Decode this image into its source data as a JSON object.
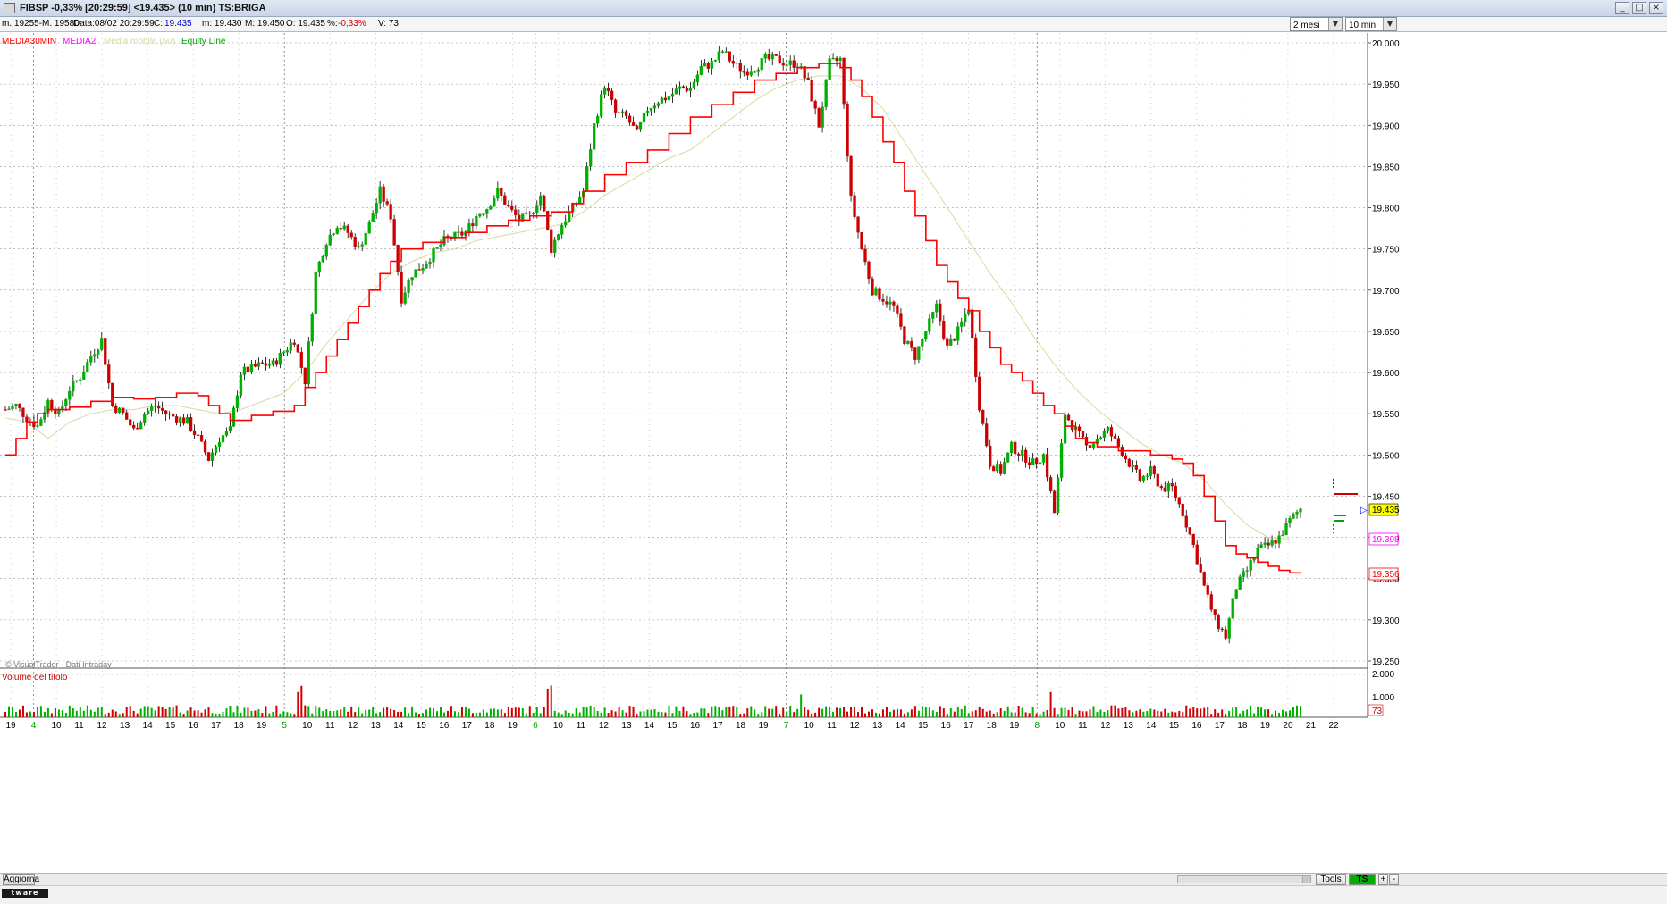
{
  "window": {
    "title": "FIBSP -0,33% [20:29:59]  <19.435> (10 min) TS:BRIGA",
    "controls": [
      "minimize",
      "maximize",
      "close"
    ]
  },
  "infobar": {
    "range": "m. 19255-M. 19580",
    "date": "Data:08/02 20:29:59",
    "close_lbl": "C:",
    "close_val": "19.435",
    "min": "m: 19.430",
    "max": "M: 19.450",
    "open": "O: 19.435",
    "pct_lbl": "%:",
    "pct_val": "-0,33%",
    "vol": "V: 73",
    "period_select": "2 mesi",
    "interval_select": "10 min"
  },
  "legend": [
    {
      "label": "MEDIA30MIN",
      "color": "#ff0000"
    },
    {
      "label": "MEDIA2",
      "color": "#ff00ff"
    },
    {
      "label": "Media mobile (50)",
      "color": "#d8d8a0"
    },
    {
      "label": "Equity Line",
      "color": "#00a000"
    }
  ],
  "copyright": "© VisualTrader - Dati Intraday",
  "volume_label": "Volume del titolo",
  "price_markers": {
    "last": "19.435",
    "media2": "19.398",
    "media30": "19.356"
  },
  "bottom": {
    "aggiorna": "Aggiorna",
    "tools": "Tools",
    "ts_on": "TS ON",
    "plus": "+",
    "minus": "-",
    "logo": "tware"
  },
  "colors": {
    "up": "#00b000",
    "down": "#cc0000",
    "ma30": "#ff0000",
    "ma50": "#d9d9a0",
    "grid": "#9a9a9a"
  },
  "chart_data": {
    "type": "candlestick",
    "yticks": [
      "20.000",
      "19.950",
      "19.900",
      "19.850",
      "19.800",
      "19.750",
      "19.700",
      "19.650",
      "19.600",
      "19.550",
      "19.500",
      "19.450",
      "19.400",
      "19.350",
      "19.300",
      "19.250"
    ],
    "ylim": [
      19.25,
      20.0
    ],
    "volume_ticks": [
      "2.000",
      "1.000",
      "73"
    ],
    "volume_ylim": [
      0,
      2000
    ],
    "x_tick_labels": [
      "19",
      "4",
      "10",
      "11",
      "12",
      "13",
      "14",
      "15",
      "16",
      "17",
      "18",
      "19",
      "5",
      "10",
      "11",
      "12",
      "13",
      "14",
      "15",
      "16",
      "17",
      "18",
      "19",
      "6",
      "10",
      "11",
      "12",
      "13",
      "14",
      "15",
      "16",
      "17",
      "18",
      "19",
      "7",
      "10",
      "11",
      "12",
      "13",
      "14",
      "15",
      "16",
      "17",
      "18",
      "19",
      "8",
      "10",
      "11",
      "12",
      "13",
      "14",
      "15",
      "16",
      "17",
      "18",
      "19",
      "20",
      "21",
      "22"
    ],
    "day_separator_labels": [
      "4",
      "5",
      "6",
      "7",
      "8"
    ],
    "close_path": [
      [
        0,
        19.555
      ],
      [
        12,
        19.56
      ],
      [
        24,
        19.545
      ],
      [
        36,
        19.535
      ],
      [
        48,
        19.565
      ],
      [
        60,
        19.55
      ],
      [
        72,
        19.58
      ],
      [
        84,
        19.595
      ],
      [
        96,
        19.62
      ],
      [
        108,
        19.64
      ],
      [
        120,
        19.56
      ],
      [
        132,
        19.55
      ],
      [
        144,
        19.53
      ],
      [
        156,
        19.55
      ],
      [
        168,
        19.56
      ],
      [
        180,
        19.55
      ],
      [
        192,
        19.545
      ],
      [
        204,
        19.54
      ],
      [
        216,
        19.52
      ],
      [
        228,
        19.495
      ],
      [
        240,
        19.52
      ],
      [
        252,
        19.53
      ],
      [
        264,
        19.6
      ],
      [
        276,
        19.605
      ],
      [
        288,
        19.61
      ],
      [
        300,
        19.61
      ],
      [
        312,
        19.625
      ],
      [
        324,
        19.64
      ],
      [
        336,
        19.59
      ],
      [
        348,
        19.72
      ],
      [
        360,
        19.76
      ],
      [
        372,
        19.78
      ],
      [
        384,
        19.77
      ],
      [
        396,
        19.75
      ],
      [
        408,
        19.78
      ],
      [
        420,
        19.82
      ],
      [
        432,
        19.79
      ],
      [
        444,
        19.69
      ],
      [
        456,
        19.72
      ],
      [
        468,
        19.73
      ],
      [
        480,
        19.745
      ],
      [
        492,
        19.76
      ],
      [
        504,
        19.765
      ],
      [
        516,
        19.77
      ],
      [
        528,
        19.79
      ],
      [
        540,
        19.8
      ],
      [
        552,
        19.82
      ],
      [
        564,
        19.8
      ],
      [
        576,
        19.785
      ],
      [
        588,
        19.79
      ],
      [
        600,
        19.815
      ],
      [
        612,
        19.75
      ],
      [
        624,
        19.78
      ],
      [
        636,
        19.8
      ],
      [
        648,
        19.82
      ],
      [
        660,
        19.9
      ],
      [
        672,
        19.95
      ],
      [
        684,
        19.915
      ],
      [
        696,
        19.91
      ],
      [
        708,
        19.89
      ],
      [
        720,
        19.92
      ],
      [
        732,
        19.93
      ],
      [
        744,
        19.935
      ],
      [
        756,
        19.945
      ],
      [
        768,
        19.945
      ],
      [
        780,
        19.97
      ],
      [
        792,
        19.975
      ],
      [
        804,
        19.99
      ],
      [
        816,
        19.975
      ],
      [
        828,
        19.965
      ],
      [
        840,
        19.97
      ],
      [
        852,
        19.98
      ],
      [
        864,
        19.98
      ],
      [
        876,
        19.975
      ],
      [
        888,
        19.975
      ],
      [
        900,
        19.95
      ],
      [
        912,
        19.9
      ],
      [
        924,
        19.975
      ],
      [
        936,
        19.98
      ],
      [
        948,
        19.81
      ],
      [
        960,
        19.75
      ],
      [
        972,
        19.7
      ],
      [
        984,
        19.69
      ],
      [
        996,
        19.68
      ],
      [
        1008,
        19.64
      ],
      [
        1020,
        19.62
      ],
      [
        1032,
        19.65
      ],
      [
        1044,
        19.68
      ],
      [
        1056,
        19.63
      ],
      [
        1068,
        19.65
      ],
      [
        1080,
        19.68
      ],
      [
        1092,
        19.56
      ],
      [
        1104,
        19.49
      ],
      [
        1116,
        19.48
      ],
      [
        1128,
        19.51
      ],
      [
        1140,
        19.5
      ],
      [
        1152,
        19.49
      ],
      [
        1164,
        19.5
      ],
      [
        1176,
        19.43
      ],
      [
        1188,
        19.55
      ],
      [
        1200,
        19.53
      ],
      [
        1212,
        19.51
      ],
      [
        1224,
        19.52
      ],
      [
        1236,
        19.53
      ],
      [
        1248,
        19.51
      ],
      [
        1260,
        19.49
      ],
      [
        1272,
        19.47
      ],
      [
        1284,
        19.48
      ],
      [
        1296,
        19.46
      ],
      [
        1308,
        19.46
      ],
      [
        1320,
        19.43
      ],
      [
        1332,
        19.39
      ],
      [
        1344,
        19.34
      ],
      [
        1356,
        19.3
      ],
      [
        1368,
        19.28
      ],
      [
        1380,
        19.34
      ],
      [
        1392,
        19.36
      ],
      [
        1404,
        19.385
      ],
      [
        1416,
        19.39
      ],
      [
        1428,
        19.4
      ],
      [
        1440,
        19.42
      ],
      [
        1452,
        19.435
      ]
    ],
    "ma30_path": [
      [
        0,
        19.5
      ],
      [
        12,
        19.52
      ],
      [
        24,
        19.54
      ],
      [
        36,
        19.55
      ],
      [
        48,
        19.555
      ],
      [
        72,
        19.558
      ],
      [
        96,
        19.565
      ],
      [
        120,
        19.57
      ],
      [
        144,
        19.568
      ],
      [
        168,
        19.57
      ],
      [
        192,
        19.575
      ],
      [
        216,
        19.572
      ],
      [
        228,
        19.56
      ],
      [
        240,
        19.55
      ],
      [
        252,
        19.542
      ],
      [
        276,
        19.548
      ],
      [
        300,
        19.553
      ],
      [
        324,
        19.56
      ],
      [
        336,
        19.582
      ],
      [
        348,
        19.6
      ],
      [
        360,
        19.62
      ],
      [
        372,
        19.64
      ],
      [
        384,
        19.66
      ],
      [
        396,
        19.68
      ],
      [
        408,
        19.7
      ],
      [
        420,
        19.72
      ],
      [
        432,
        19.735
      ],
      [
        444,
        19.75
      ],
      [
        468,
        19.758
      ],
      [
        492,
        19.764
      ],
      [
        516,
        19.77
      ],
      [
        540,
        19.778
      ],
      [
        564,
        19.785
      ],
      [
        588,
        19.79
      ],
      [
        612,
        19.795
      ],
      [
        636,
        19.805
      ],
      [
        648,
        19.82
      ],
      [
        672,
        19.84
      ],
      [
        696,
        19.855
      ],
      [
        720,
        19.87
      ],
      [
        744,
        19.89
      ],
      [
        768,
        19.91
      ],
      [
        792,
        19.925
      ],
      [
        816,
        19.94
      ],
      [
        840,
        19.955
      ],
      [
        864,
        19.963
      ],
      [
        888,
        19.97
      ],
      [
        912,
        19.975
      ],
      [
        936,
        19.97
      ],
      [
        948,
        19.955
      ],
      [
        960,
        19.935
      ],
      [
        972,
        19.91
      ],
      [
        984,
        19.88
      ],
      [
        996,
        19.855
      ],
      [
        1008,
        19.82
      ],
      [
        1020,
        19.79
      ],
      [
        1032,
        19.76
      ],
      [
        1044,
        19.73
      ],
      [
        1056,
        19.71
      ],
      [
        1068,
        19.69
      ],
      [
        1080,
        19.675
      ],
      [
        1092,
        19.65
      ],
      [
        1104,
        19.63
      ],
      [
        1116,
        19.61
      ],
      [
        1128,
        19.6
      ],
      [
        1140,
        19.59
      ],
      [
        1152,
        19.575
      ],
      [
        1164,
        19.56
      ],
      [
        1176,
        19.55
      ],
      [
        1188,
        19.535
      ],
      [
        1200,
        19.52
      ],
      [
        1212,
        19.515
      ],
      [
        1224,
        19.51
      ],
      [
        1236,
        19.51
      ],
      [
        1248,
        19.505
      ],
      [
        1260,
        19.505
      ],
      [
        1272,
        19.505
      ],
      [
        1284,
        19.5
      ],
      [
        1296,
        19.5
      ],
      [
        1308,
        19.495
      ],
      [
        1320,
        19.49
      ],
      [
        1332,
        19.475
      ],
      [
        1344,
        19.45
      ],
      [
        1356,
        19.42
      ],
      [
        1368,
        19.39
      ],
      [
        1380,
        19.38
      ],
      [
        1392,
        19.375
      ],
      [
        1404,
        19.37
      ],
      [
        1416,
        19.365
      ],
      [
        1428,
        19.36
      ],
      [
        1440,
        19.357
      ],
      [
        1452,
        19.356
      ]
    ],
    "ma50_path": [
      [
        0,
        19.545
      ],
      [
        24,
        19.54
      ],
      [
        48,
        19.52
      ],
      [
        72,
        19.54
      ],
      [
        96,
        19.55
      ],
      [
        120,
        19.555
      ],
      [
        144,
        19.555
      ],
      [
        168,
        19.56
      ],
      [
        192,
        19.56
      ],
      [
        216,
        19.555
      ],
      [
        240,
        19.55
      ],
      [
        264,
        19.555
      ],
      [
        288,
        19.565
      ],
      [
        312,
        19.575
      ],
      [
        336,
        19.6
      ],
      [
        360,
        19.635
      ],
      [
        384,
        19.665
      ],
      [
        408,
        19.695
      ],
      [
        432,
        19.72
      ],
      [
        456,
        19.735
      ],
      [
        480,
        19.745
      ],
      [
        504,
        19.75
      ],
      [
        528,
        19.76
      ],
      [
        552,
        19.765
      ],
      [
        576,
        19.77
      ],
      [
        600,
        19.775
      ],
      [
        624,
        19.78
      ],
      [
        648,
        19.795
      ],
      [
        672,
        19.815
      ],
      [
        696,
        19.83
      ],
      [
        720,
        19.845
      ],
      [
        744,
        19.86
      ],
      [
        768,
        19.87
      ],
      [
        792,
        19.89
      ],
      [
        816,
        19.91
      ],
      [
        840,
        19.93
      ],
      [
        864,
        19.945
      ],
      [
        888,
        19.955
      ],
      [
        912,
        19.96
      ],
      [
        936,
        19.96
      ],
      [
        960,
        19.945
      ],
      [
        984,
        19.92
      ],
      [
        1008,
        19.88
      ],
      [
        1032,
        19.84
      ],
      [
        1056,
        19.8
      ],
      [
        1080,
        19.76
      ],
      [
        1104,
        19.72
      ],
      [
        1128,
        19.685
      ],
      [
        1152,
        19.645
      ],
      [
        1176,
        19.61
      ],
      [
        1200,
        19.58
      ],
      [
        1224,
        19.555
      ],
      [
        1248,
        19.535
      ],
      [
        1272,
        19.515
      ],
      [
        1296,
        19.5
      ],
      [
        1320,
        19.49
      ],
      [
        1344,
        19.47
      ],
      [
        1368,
        19.44
      ],
      [
        1392,
        19.415
      ],
      [
        1416,
        19.4
      ],
      [
        1440,
        19.398
      ]
    ]
  }
}
